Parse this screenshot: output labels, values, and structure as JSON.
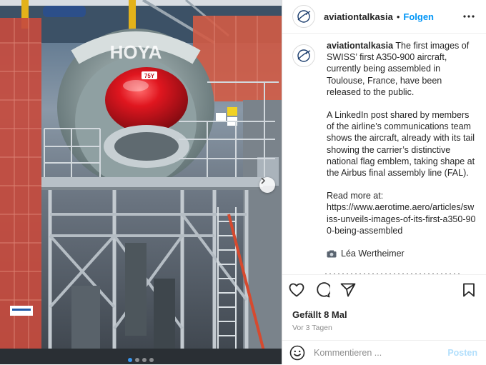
{
  "post": {
    "username": "aviationtalkasia",
    "separator": "•",
    "follow_label": "Folgen",
    "caption": {
      "username": "aviationtalkasia",
      "paragraph1": "The first images of SWISS’ first A350-900 aircraft, currently being assembled in Toulouse, France, have been released to the public.",
      "paragraph2": "A LinkedIn post shared by members of the airline’s communications team shows the aircraft, already with its tail showing the carrier’s distinctive national flag emblem, taking shape at the Airbus final assembly line (FAL).",
      "read_more_label": "Read more at:",
      "link": "https://www.aerotime.aero/articles/swiss-unveils-images-of-its-first-a350-900-being-assembled",
      "author": "Léa Wertheimer"
    },
    "likes": "Gefällt 8 Mal",
    "date": "Vor 3 Tagen",
    "comment": {
      "placeholder": "Kommentieren ...",
      "post_label": "Posten"
    }
  },
  "media": {
    "aircraft_marking": "75Y",
    "carousel": {
      "count": 4,
      "active": 0
    }
  },
  "icons": {
    "avatar": "airplane-logo-icon",
    "more": "more-options-icon",
    "like": "heart-icon",
    "comment": "comment-bubble-icon",
    "share": "paper-plane-icon",
    "save": "bookmark-icon",
    "emoji": "emoji-icon",
    "next": "chevron-right-icon",
    "author": "camera-icon"
  },
  "colors": {
    "accent": "#0095f6",
    "post_disabled": "#b2dffc",
    "muted": "#8e8e8e",
    "nose_red": "#d4151e"
  }
}
